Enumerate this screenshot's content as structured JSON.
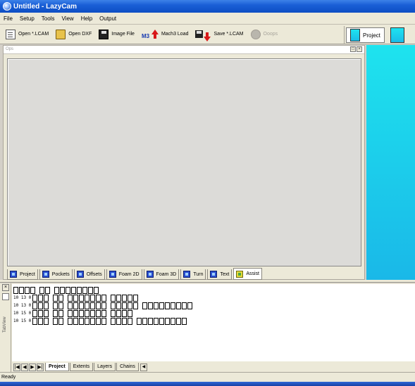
{
  "window": {
    "title": "Untitled - LazyCam"
  },
  "menu": [
    "File",
    "Setup",
    "Tools",
    "View",
    "Help",
    "Output"
  ],
  "toolbar": {
    "open_lcam": "Open *.LCAM",
    "open_dxf": "Open DXF",
    "image_file": "Image File",
    "m3_badge": "M3",
    "mach3_load": "Mach3 Load",
    "save_lcam": "Save *.LCAM",
    "ooops": "Ooops",
    "project": "Project"
  },
  "ops": {
    "header": "Ops",
    "tabs": [
      "Project",
      "Pockets",
      "Offsets",
      "Foam 2D",
      "Foam 3D",
      "Turn",
      "Text",
      "Assist"
    ],
    "active_tab": "Assist"
  },
  "log": {
    "tabview_label": "TabView",
    "lines": [
      {
        "prefix": "",
        "words": [
          4,
          2,
          8
        ]
      },
      {
        "prefix": "10 13 0 ",
        "words": [
          3,
          2,
          7,
          5
        ]
      },
      {
        "prefix": "10 13 0 ",
        "words": [
          3,
          2,
          7,
          5,
          9
        ]
      },
      {
        "prefix": "10 15 0 ",
        "words": [
          3,
          2,
          7,
          4
        ]
      },
      {
        "prefix": "10 15 0 ",
        "words": [
          3,
          2,
          7,
          4,
          9
        ]
      }
    ]
  },
  "bottom_tabs": [
    "Project",
    "Extents",
    "Layers",
    "Chains"
  ],
  "bottom_active_tab": "Project",
  "status": {
    "text": "Ready"
  }
}
